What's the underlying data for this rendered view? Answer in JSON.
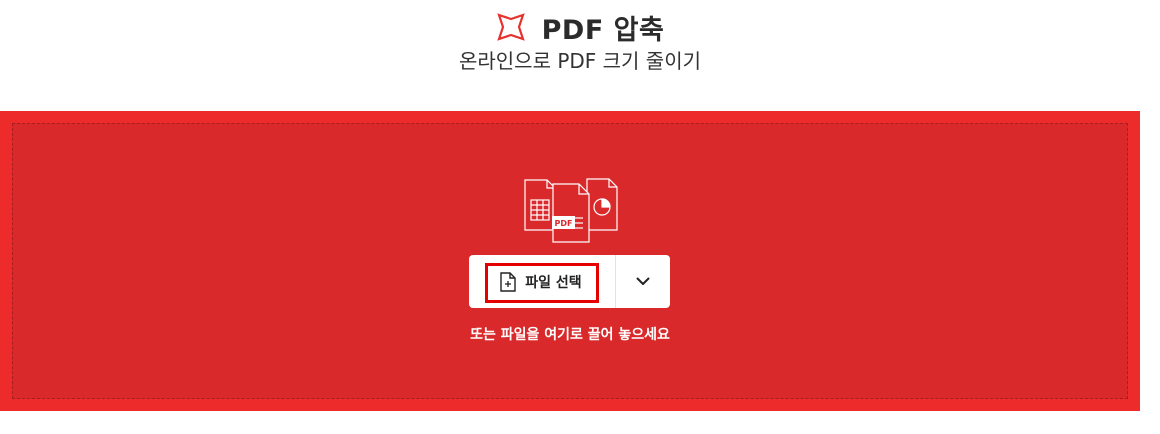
{
  "header": {
    "title": "PDF 압축",
    "subtitle": "온라인으로 PDF 크기 줄이기",
    "icon": "compress-icon",
    "icon_color": "#e5322d"
  },
  "dropzone": {
    "background": "#ee2b2b",
    "inner_background": "#d9292b",
    "illustration": "document-files-icon",
    "illustration_badge": "PDF",
    "select_button": {
      "label": "파일 선택",
      "icon": "file-plus-icon"
    },
    "dropdown_button": {
      "icon": "chevron-down-icon"
    },
    "hint": "또는 파일을 여기로 끌어 놓으세요"
  }
}
